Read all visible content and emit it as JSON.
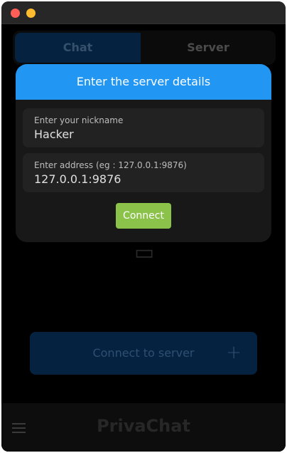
{
  "window": {
    "controls": [
      "close",
      "minimize"
    ]
  },
  "tabs": [
    {
      "label": "Chat",
      "active": true
    },
    {
      "label": "Server",
      "active": false
    }
  ],
  "dialog": {
    "title": "Enter the server details",
    "nickname": {
      "label": "Enter your nickname",
      "value": "Hacker"
    },
    "address": {
      "label": "Enter address (eg : 127.0.0.1:9876)",
      "value": "127.0.0.1:9876"
    },
    "connect_label": "Connect"
  },
  "main": {
    "connect_server_label": "Connect to server",
    "connect_server_icon": "+"
  },
  "bottom_bar": {
    "menu_icon": "hamburger-menu",
    "app_title": "PrivaChat"
  },
  "colors": {
    "accent": "#2196f3",
    "connect_button": "#8bc34a",
    "close_dot": "#ff5f57",
    "minimize_dot": "#febc2e"
  }
}
